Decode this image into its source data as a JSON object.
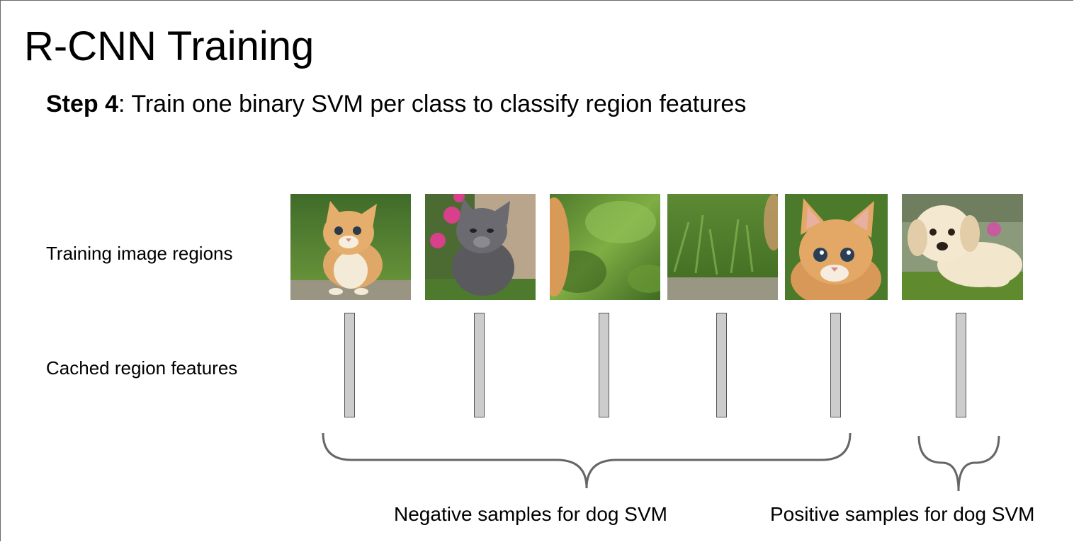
{
  "slide": {
    "title": "R-CNN Training",
    "step_label": "Step 4",
    "step_text": ": Train one binary SVM per class to classify region features"
  },
  "rows": {
    "regions_label": "Training image regions",
    "features_label": "Cached region features"
  },
  "regions": [
    {
      "subject": "orange-kitten-full"
    },
    {
      "subject": "gray-kitten-with-flowers"
    },
    {
      "subject": "grass-background"
    },
    {
      "subject": "grass-and-rock-background"
    },
    {
      "subject": "orange-kitten-face-closeup"
    },
    {
      "subject": "golden-retriever-puppy"
    }
  ],
  "groups": {
    "negative_label": "Negative samples for dog SVM",
    "positive_label": "Positive samples for dog SVM"
  },
  "colors": {
    "feature_fill": "#cccccc",
    "feature_border": "#555555",
    "brace": "#666666"
  }
}
